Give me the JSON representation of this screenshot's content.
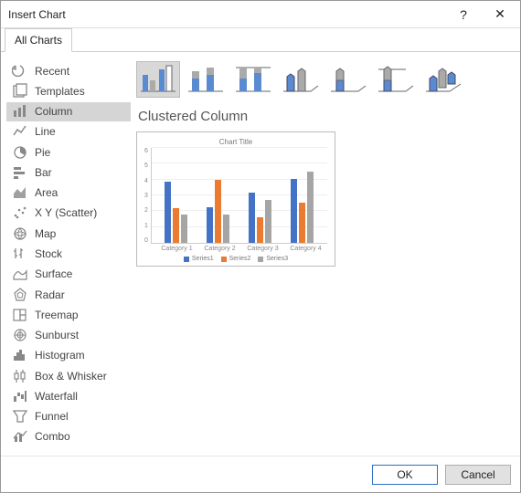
{
  "dialog": {
    "title": "Insert Chart",
    "help_tooltip": "?",
    "close_tooltip": "✕"
  },
  "tabs": {
    "all_charts": "All Charts"
  },
  "sidebar": {
    "items": [
      {
        "label": "Recent"
      },
      {
        "label": "Templates"
      },
      {
        "label": "Column"
      },
      {
        "label": "Line"
      },
      {
        "label": "Pie"
      },
      {
        "label": "Bar"
      },
      {
        "label": "Area"
      },
      {
        "label": "X Y (Scatter)"
      },
      {
        "label": "Map"
      },
      {
        "label": "Stock"
      },
      {
        "label": "Surface"
      },
      {
        "label": "Radar"
      },
      {
        "label": "Treemap"
      },
      {
        "label": "Sunburst"
      },
      {
        "label": "Histogram"
      },
      {
        "label": "Box & Whisker"
      },
      {
        "label": "Waterfall"
      },
      {
        "label": "Funnel"
      },
      {
        "label": "Combo"
      }
    ],
    "selected_index": 2
  },
  "preview": {
    "title": "Clustered Column",
    "chart_title": "Chart Title"
  },
  "chart_data": {
    "type": "bar",
    "title": "Chart Title",
    "categories": [
      "Category 1",
      "Category 2",
      "Category 3",
      "Category 4"
    ],
    "series": [
      {
        "name": "Series1",
        "values": [
          4.3,
          2.5,
          3.5,
          4.5
        ]
      },
      {
        "name": "Series2",
        "values": [
          2.4,
          4.4,
          1.8,
          2.8
        ]
      },
      {
        "name": "Series3",
        "values": [
          2.0,
          2.0,
          3.0,
          5.0
        ]
      }
    ],
    "ylabel": "",
    "xlabel": "",
    "yticks": [
      0,
      1,
      2,
      3,
      4,
      5,
      6
    ],
    "ylim": [
      0,
      6
    ],
    "colors": {
      "Series1": "#4473c5",
      "Series2": "#eb7b30",
      "Series3": "#a5a5a5"
    }
  },
  "footer": {
    "ok": "OK",
    "cancel": "Cancel"
  }
}
